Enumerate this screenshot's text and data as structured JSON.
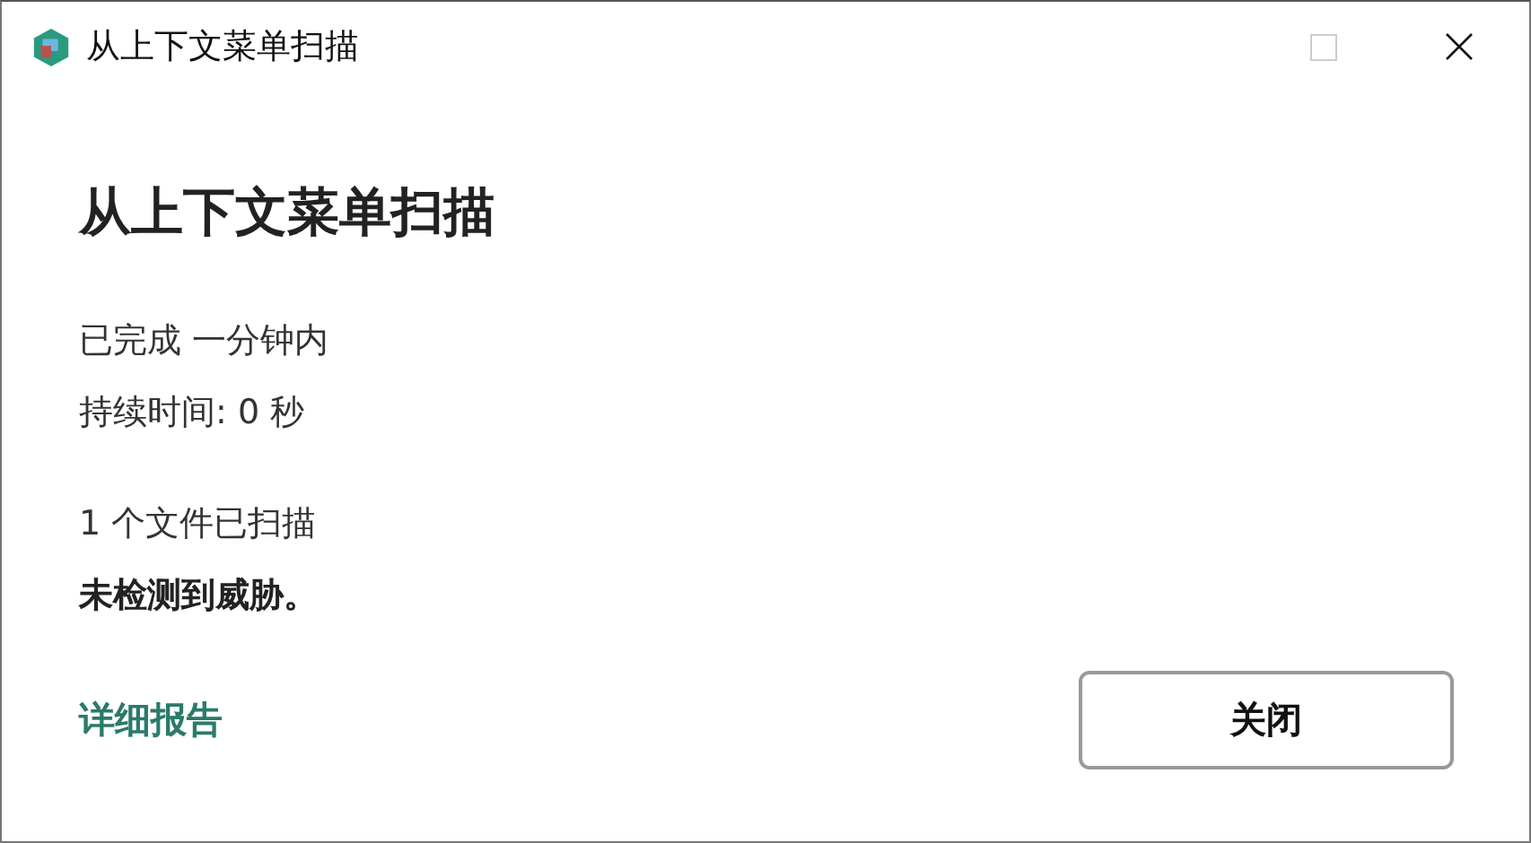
{
  "window": {
    "title": "从上下文菜单扫描",
    "maximize_disabled": true
  },
  "heading": "从上下文菜单扫描",
  "status_lines": [
    "已完成 一分钟内",
    "持续时间: 0 秒"
  ],
  "result_lines": [
    {
      "text": "1 个文件已扫描",
      "bold": false
    },
    {
      "text": "未检测到威胁。",
      "bold": true
    }
  ],
  "report_link": "详细报告",
  "buttons": [
    "关闭"
  ]
}
